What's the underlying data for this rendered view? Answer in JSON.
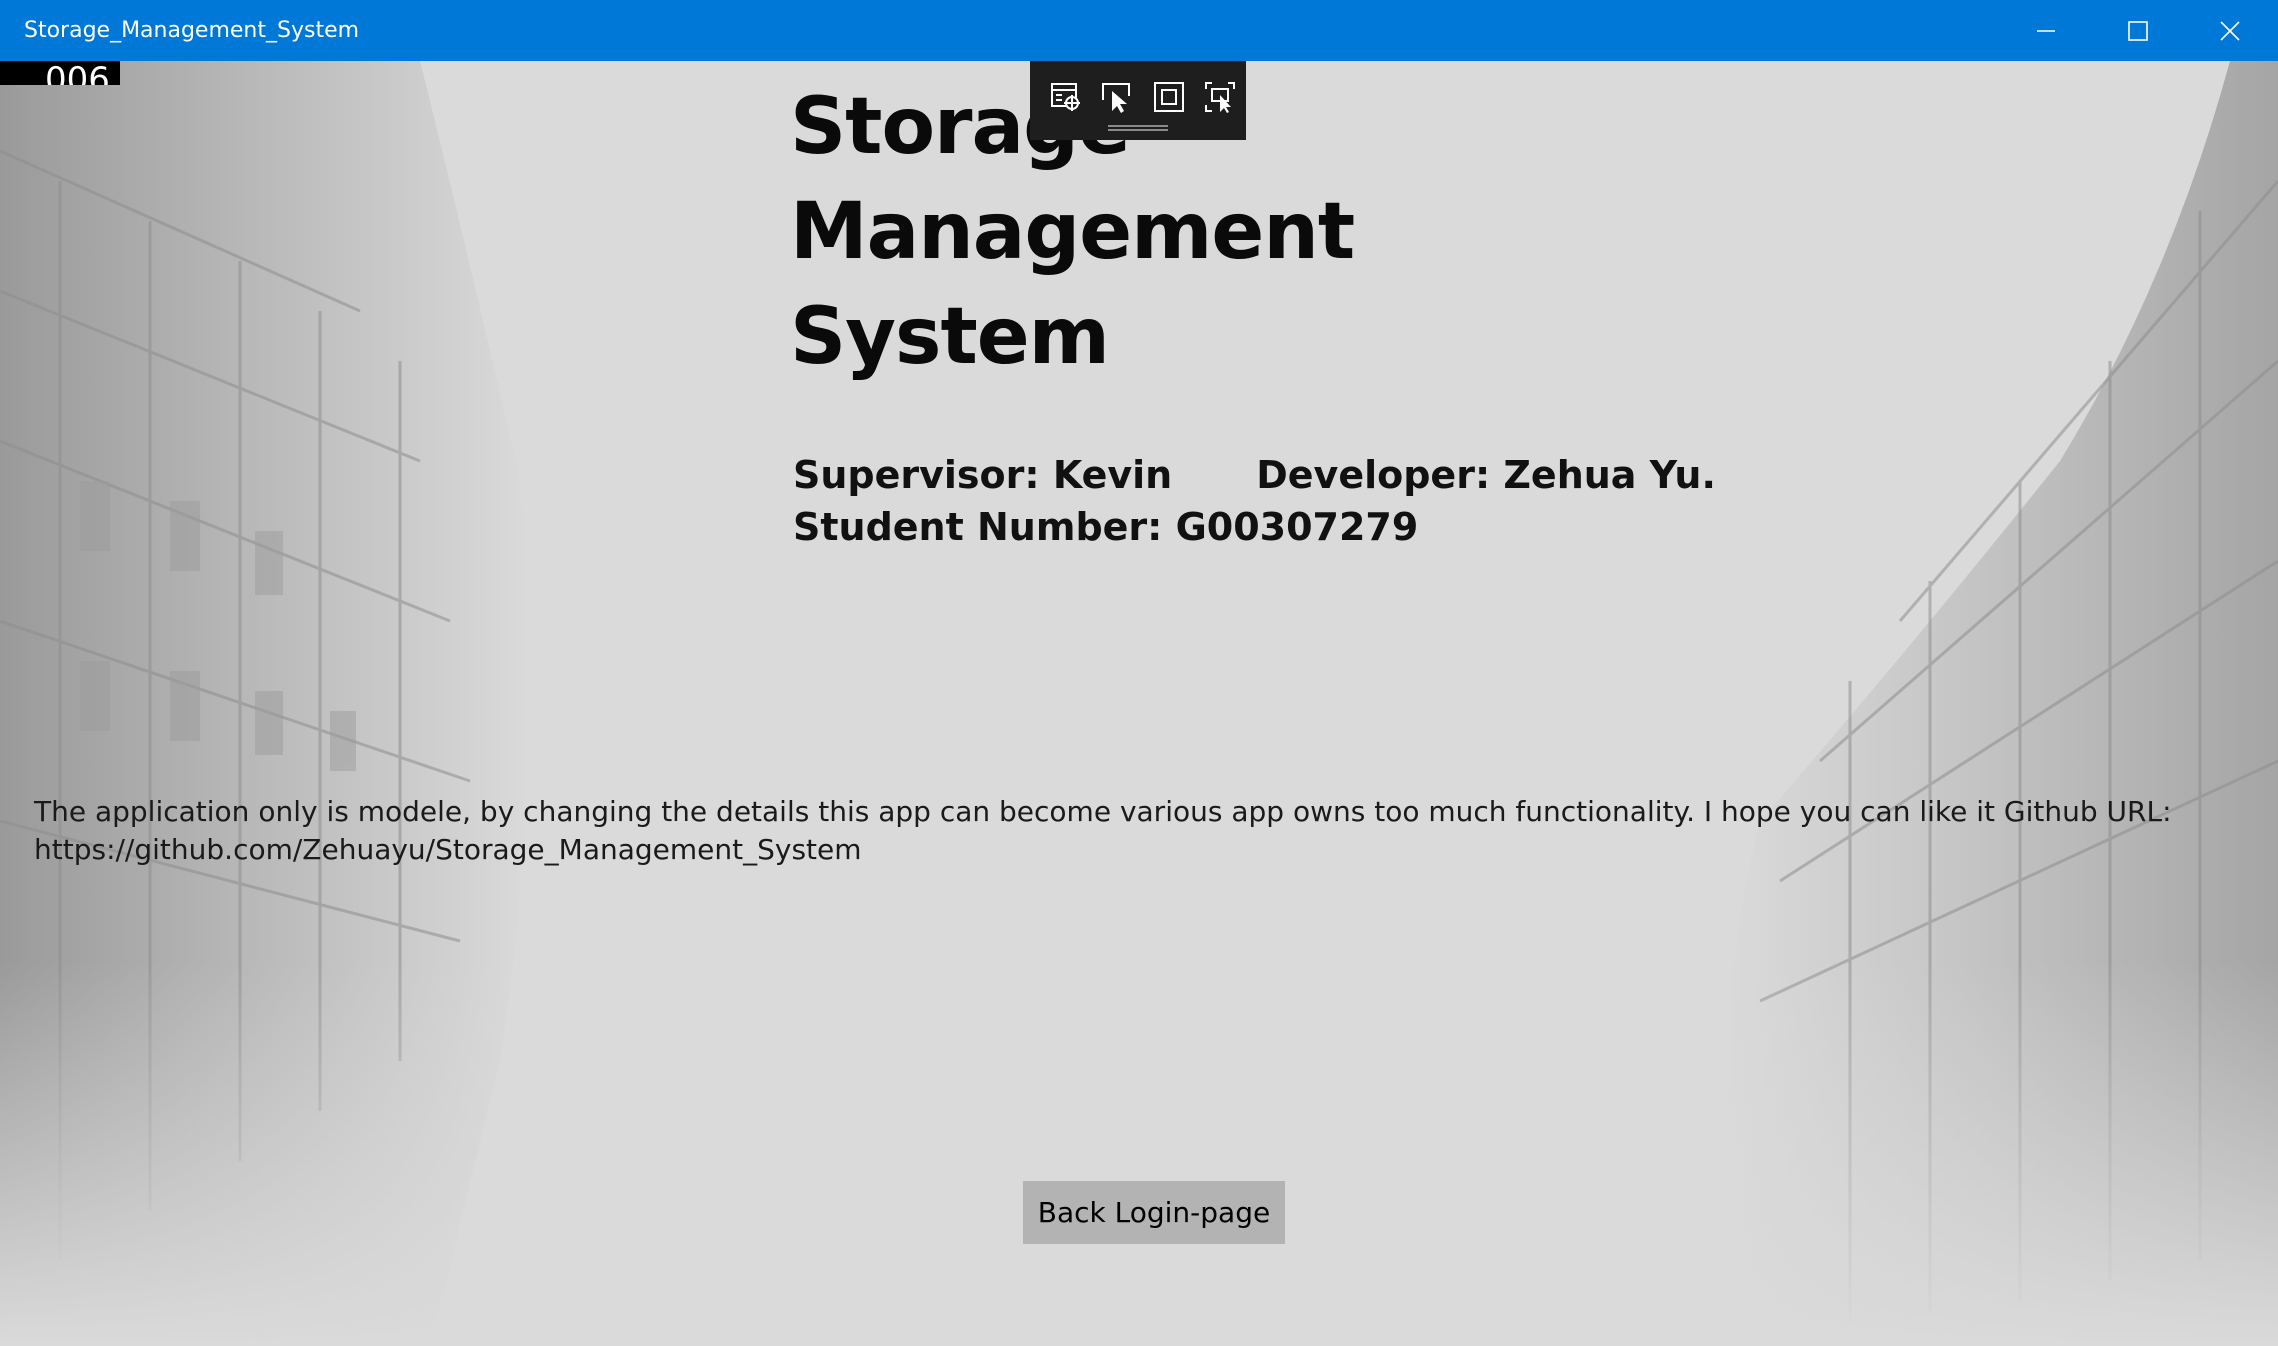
{
  "window": {
    "title": "Storage_Management_System"
  },
  "counter": {
    "value": "006"
  },
  "page": {
    "title": "Storage Management System",
    "supervisor": "Supervisor: Kevin",
    "developer": "Developer: Zehua Yu.",
    "student_number": "Student Number: G00307279",
    "description": "The application only is modele, by changing the details this app can become various app owns too much functionality. I hope you can like it  Github URL:   https://github.com/Zehuayu/Storage_Management_System",
    "back_button_label": "Back Login-page"
  },
  "debug_toolbar": {
    "tools": [
      "select-element-icon",
      "cursor-select-icon",
      "display-layout-icon",
      "track-focus-icon"
    ]
  },
  "colors": {
    "titlebar": "#0078d7",
    "background": "#dadada",
    "button": "#b3b3b3"
  }
}
